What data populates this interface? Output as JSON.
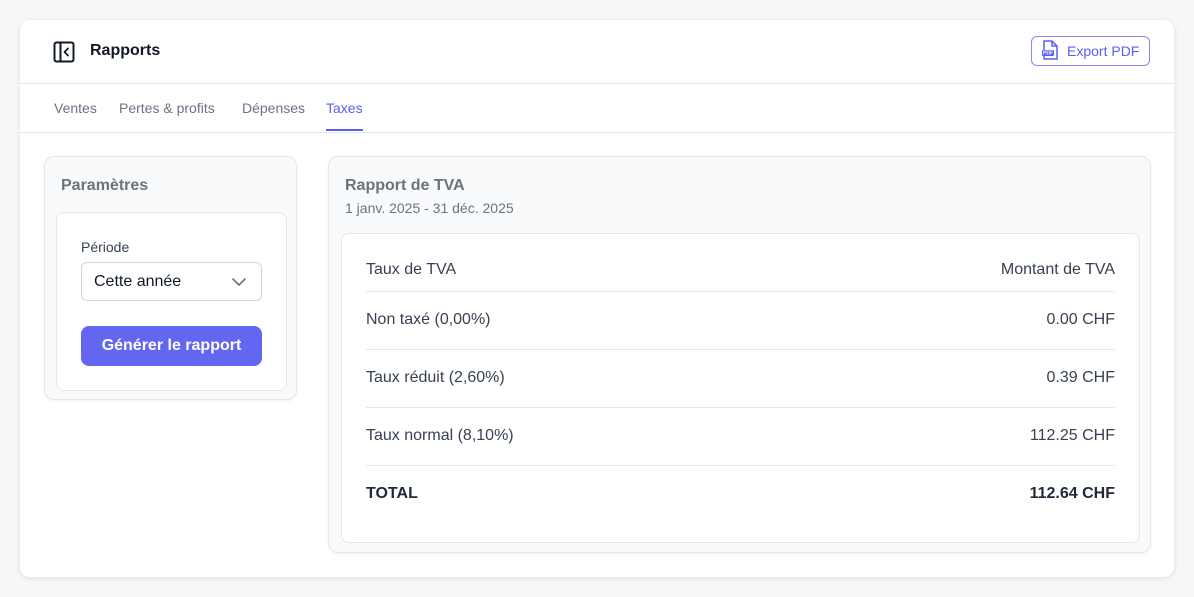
{
  "header": {
    "title": "Rapports",
    "export_label": "Export PDF",
    "export_icon_text": "PDF"
  },
  "tabs": [
    {
      "label": "Ventes",
      "active": false
    },
    {
      "label": "Pertes & profits",
      "active": false
    },
    {
      "label": "Dépenses",
      "active": false
    },
    {
      "label": "Taxes",
      "active": true
    }
  ],
  "params": {
    "title": "Paramètres",
    "period_label": "Période",
    "period_value": "Cette année",
    "generate_label": "Générer le rapport"
  },
  "report": {
    "title": "Rapport de TVA",
    "range": "1 janv. 2025 - 31 déc. 2025",
    "columns": [
      "Taux de TVA",
      "Montant de TVA"
    ],
    "rows": [
      {
        "rate": "Non taxé (0,00%)",
        "amount": "0.00 CHF"
      },
      {
        "rate": "Taux réduit (2,60%)",
        "amount": "0.39 CHF"
      },
      {
        "rate": "Taux normal (8,10%)",
        "amount": "112.25 CHF"
      }
    ],
    "total": {
      "label": "TOTAL",
      "amount": "112.64 CHF"
    }
  },
  "colors": {
    "accent": "#6366f1",
    "accent_text": "#5b5ef0",
    "border": "#e5e7eb"
  },
  "icons": {
    "sidebar_toggle": "sidebar-collapse-icon",
    "export": "pdf-file-icon",
    "select": "chevron-down-icon"
  }
}
